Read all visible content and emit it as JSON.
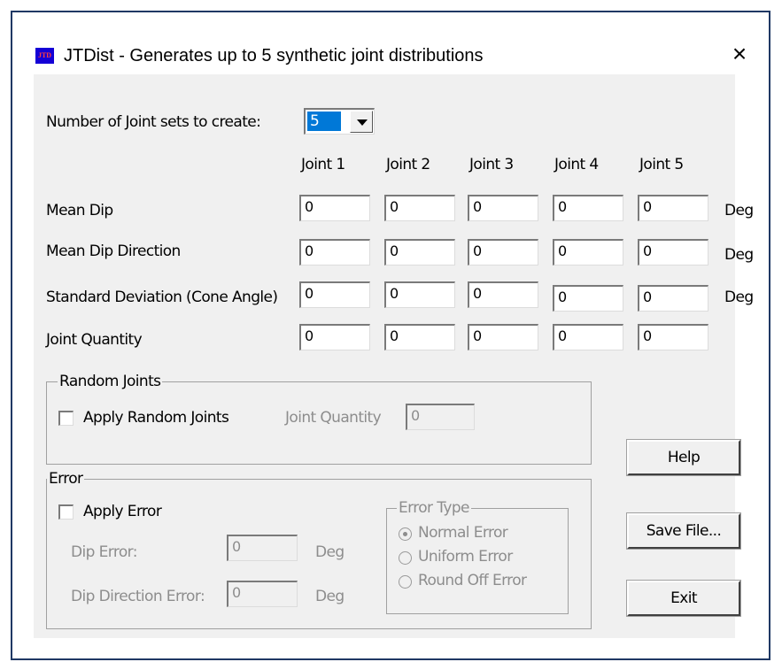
{
  "window": {
    "title": "JTDist - Generates up to 5 synthetic joint distributions",
    "icon_text": "JTD",
    "close_glyph": "×"
  },
  "joint_sets": {
    "label": "Number of Joint sets to create:",
    "selected": "5"
  },
  "columns": [
    "Joint 1",
    "Joint 2",
    "Joint 3",
    "Joint 4",
    "Joint 5"
  ],
  "rows": [
    {
      "label": "Mean Dip",
      "values": [
        "0",
        "0",
        "0",
        "0",
        "0"
      ],
      "unit": "Deg"
    },
    {
      "label": "Mean Dip Direction",
      "values": [
        "0",
        "0",
        "0",
        "0",
        "0"
      ],
      "unit": "Deg"
    },
    {
      "label": "Standard Deviation (Cone Angle)",
      "values": [
        "0",
        "0",
        "0",
        "0",
        "0"
      ],
      "unit": "Deg"
    },
    {
      "label": "Joint Quantity",
      "values": [
        "0",
        "0",
        "0",
        "0",
        "0"
      ],
      "unit": ""
    }
  ],
  "random_joints": {
    "group_title": "Random Joints",
    "checkbox_label": "Apply Random Joints",
    "quantity_label": "Joint Quantity",
    "quantity_value": "0"
  },
  "error": {
    "group_title": "Error",
    "checkbox_label": "Apply Error",
    "dip_error_label": "Dip Error:",
    "dip_error_value": "0",
    "dip_error_unit": "Deg",
    "dip_dir_error_label": "Dip Direction Error:",
    "dip_dir_error_value": "0",
    "dip_dir_error_unit": "Deg",
    "type_group_title": "Error Type",
    "types": [
      "Normal Error",
      "Uniform Error",
      "Round Off Error"
    ]
  },
  "buttons": {
    "help": "Help",
    "save": "Save File...",
    "exit": "Exit"
  }
}
